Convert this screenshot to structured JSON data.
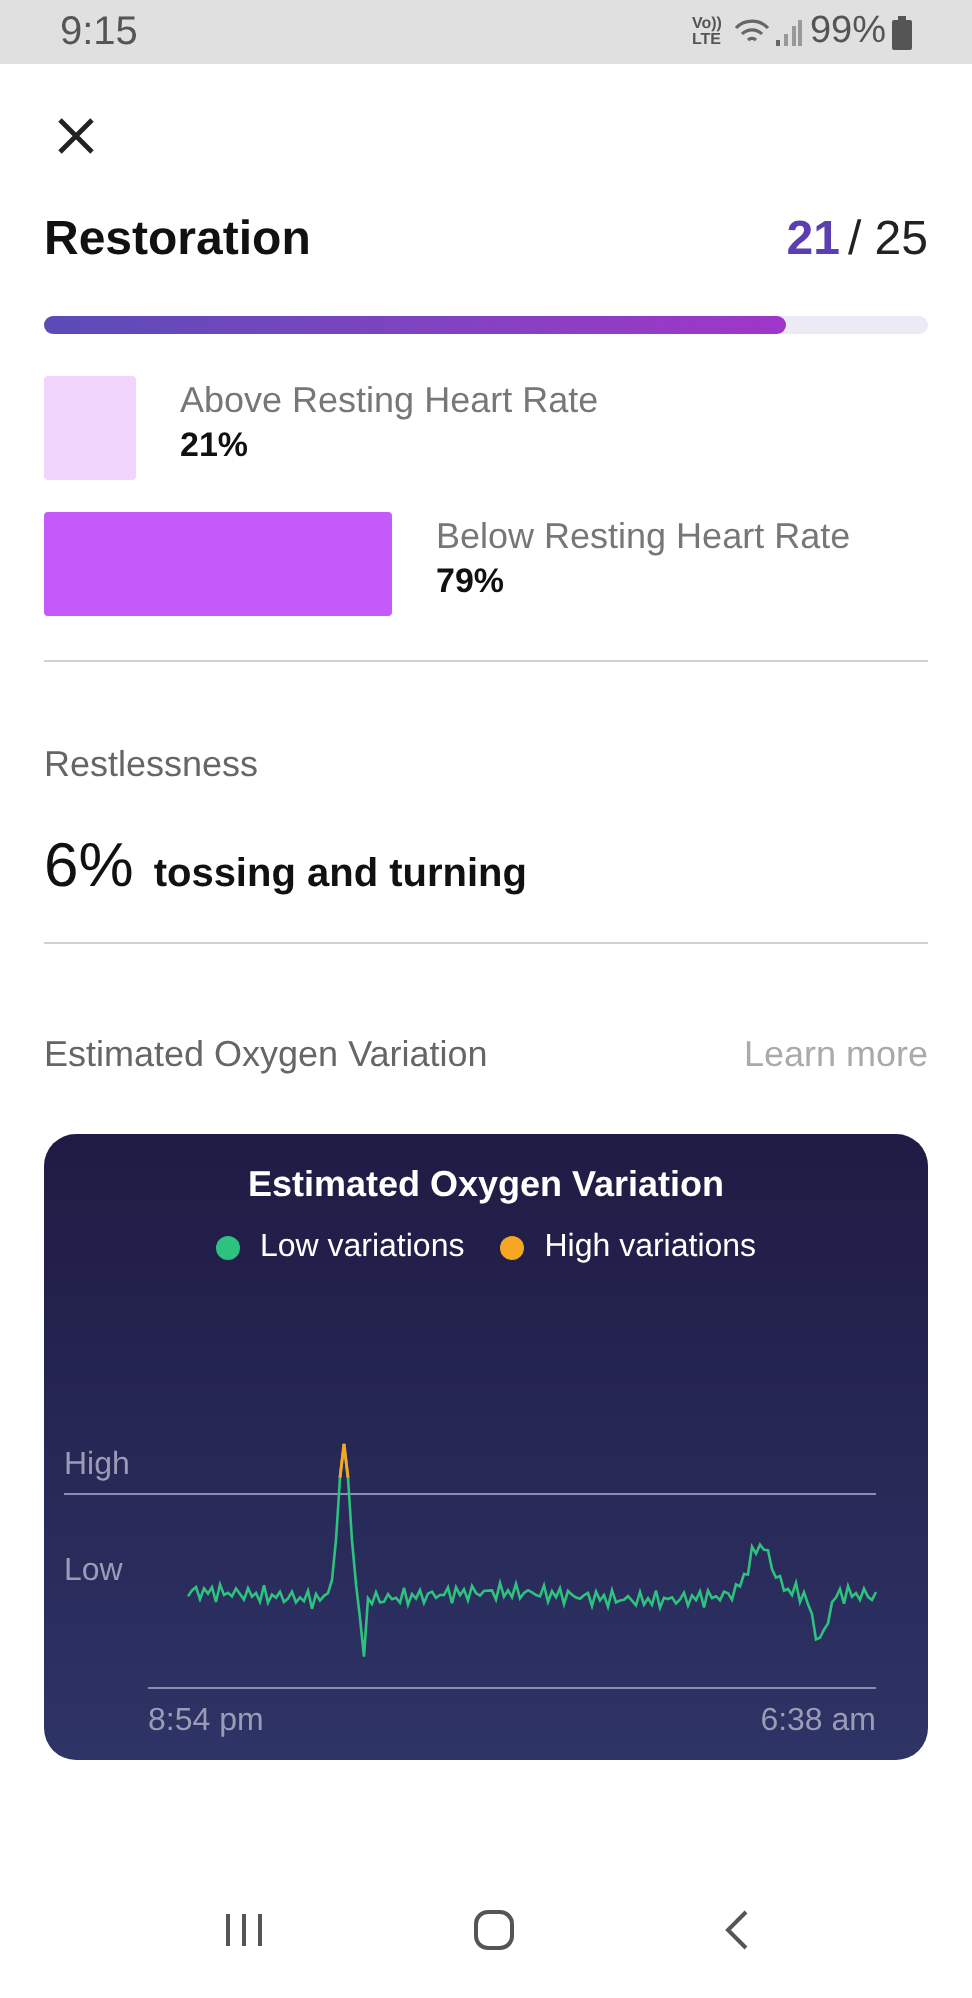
{
  "status_bar": {
    "time": "9:15",
    "volte_top": "Vo))",
    "volte_bottom": "LTE",
    "battery": "99%"
  },
  "restoration": {
    "title": "Restoration",
    "score": "21",
    "total": "/ 25",
    "level": 0.84,
    "segments": [
      {
        "label": "Above Resting Heart Rate",
        "value": "21%",
        "color": "#f0d4fb"
      },
      {
        "label": "Below Resting Heart Rate",
        "value": "79%",
        "color": "#c659f9"
      }
    ]
  },
  "restlessness": {
    "title": "Restlessness",
    "value": "6%",
    "caption": "tossing and turning"
  },
  "oxygen": {
    "title": "Estimated Oxygen Variation",
    "link": "Learn more",
    "card": {
      "title": "Estimated Oxygen Variation",
      "legend": [
        {
          "label": "Low variations",
          "color": "#2ec27e"
        },
        {
          "label": "High variations",
          "color": "#f5a623"
        }
      ],
      "y_labels": [
        "High",
        "Low"
      ],
      "x_labels": [
        "8:54 pm",
        "6:38 am"
      ]
    }
  }
}
